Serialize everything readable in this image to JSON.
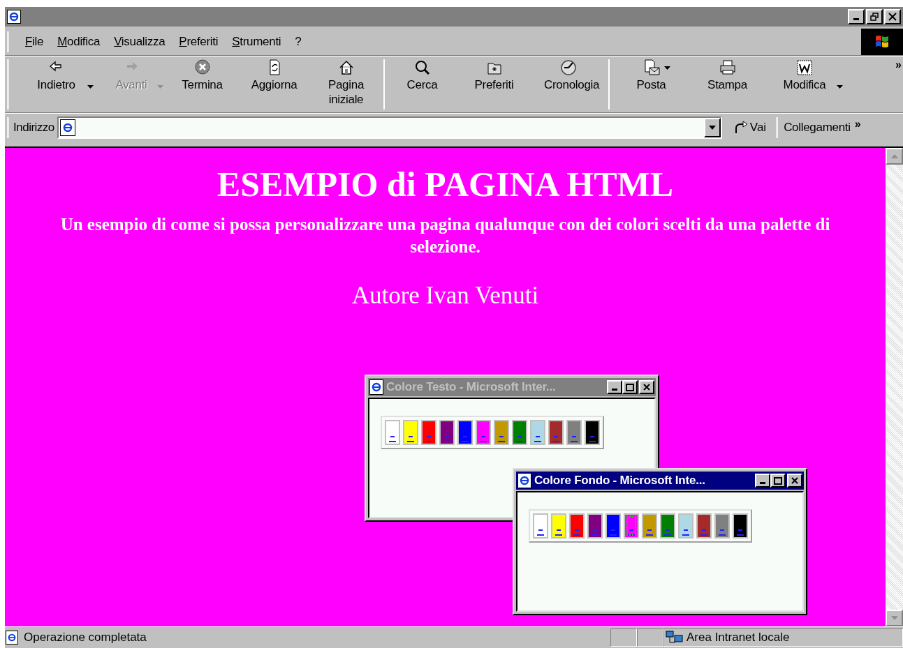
{
  "window": {
    "title_active": false
  },
  "menu": [
    {
      "label": "File"
    },
    {
      "label": "Modifica"
    },
    {
      "label": "Visualizza"
    },
    {
      "label": "Preferiti"
    },
    {
      "label": "Strumenti"
    },
    {
      "label": "?"
    }
  ],
  "toolbar_more": "»",
  "toolbar": [
    {
      "kind": "back",
      "label": "Indietro",
      "disabled": false,
      "dropdown": true
    },
    {
      "kind": "forward",
      "label": "Avanti",
      "disabled": true,
      "dropdown": true
    },
    {
      "kind": "stop",
      "label": "Termina",
      "disabled": false,
      "dropdown": false
    },
    {
      "kind": "refresh",
      "label": "Aggiorna",
      "disabled": false,
      "dropdown": false
    },
    {
      "kind": "home",
      "label": "Pagina iniziale",
      "disabled": false,
      "dropdown": false
    },
    {
      "kind": "separator"
    },
    {
      "kind": "search",
      "label": "Cerca",
      "disabled": false,
      "dropdown": false
    },
    {
      "kind": "favorites",
      "label": "Preferiti",
      "disabled": false,
      "dropdown": false
    },
    {
      "kind": "history",
      "label": "Cronologia",
      "disabled": false,
      "dropdown": false
    },
    {
      "kind": "separator"
    },
    {
      "kind": "mail",
      "label": "Posta",
      "disabled": false,
      "dropdown": true
    },
    {
      "kind": "print",
      "label": "Stampa",
      "disabled": false,
      "dropdown": false
    },
    {
      "kind": "edit",
      "label": "Modifica",
      "disabled": false,
      "dropdown": true
    }
  ],
  "address_bar": {
    "label": "Indirizzo",
    "go": "Vai",
    "links": "Collegamenti",
    "links_more": "»"
  },
  "page": {
    "heading": "ESEMPIO di PAGINA HTML",
    "subtitle": "Un esempio di come si possa personalizzare una pagina qualunque con dei colori scelti da una palette di selezione.",
    "author": "Autore Ivan Venuti"
  },
  "popups": [
    {
      "title": "Colore Testo - Microsoft Inter...",
      "active": false,
      "swatches": [
        {
          "color": "#ffffff",
          "selected": false
        },
        {
          "color": "#ffff00",
          "selected": false
        },
        {
          "color": "#ff0000",
          "selected": false
        },
        {
          "color": "#800080",
          "selected": false
        },
        {
          "color": "#0000ff",
          "selected": false
        },
        {
          "color": "#ff00ff",
          "selected": false
        },
        {
          "color": "#c09a00",
          "selected": false
        },
        {
          "color": "#008000",
          "selected": false
        },
        {
          "color": "#add8e6",
          "selected": false
        },
        {
          "color": "#a52a2a",
          "selected": false
        },
        {
          "color": "#808080",
          "selected": false
        },
        {
          "color": "#000000",
          "selected": false
        }
      ]
    },
    {
      "title": "Colore Fondo - Microsoft Inte...",
      "active": true,
      "swatches": [
        {
          "color": "#ffffff",
          "selected": false
        },
        {
          "color": "#ffff00",
          "selected": false
        },
        {
          "color": "#ff0000",
          "selected": false
        },
        {
          "color": "#800080",
          "selected": false
        },
        {
          "color": "#0000ff",
          "selected": false
        },
        {
          "color": "#ff00ff",
          "selected": true
        },
        {
          "color": "#c09a00",
          "selected": false
        },
        {
          "color": "#008000",
          "selected": false
        },
        {
          "color": "#add8e6",
          "selected": false
        },
        {
          "color": "#a52a2a",
          "selected": false
        },
        {
          "color": "#808080",
          "selected": false
        },
        {
          "color": "#000000",
          "selected": false
        }
      ]
    }
  ],
  "status_bar": {
    "text": "Operazione completata",
    "zone": "Area Intranet locale"
  }
}
